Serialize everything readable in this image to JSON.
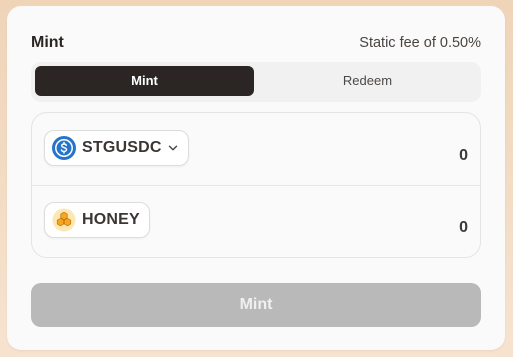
{
  "form": {
    "title": "Mint",
    "fee_text": "Static fee of 0.50%"
  },
  "tabs": [
    {
      "label": "Mint",
      "active": true
    },
    {
      "label": "Redeem",
      "active": false
    }
  ],
  "input_token": {
    "symbol": "STGUSDC",
    "icon": "usdc-icon",
    "amount": "0"
  },
  "output_token": {
    "symbol": "HONEY",
    "icon": "honey-icon",
    "amount": "0"
  },
  "submit": {
    "label": "Mint",
    "disabled": true
  },
  "colors": {
    "primary_dark": "#2b2623",
    "disabled_button": "#b9b9b9",
    "usdc_blue": "#2775ca",
    "honey_gold": "#f5a623"
  }
}
